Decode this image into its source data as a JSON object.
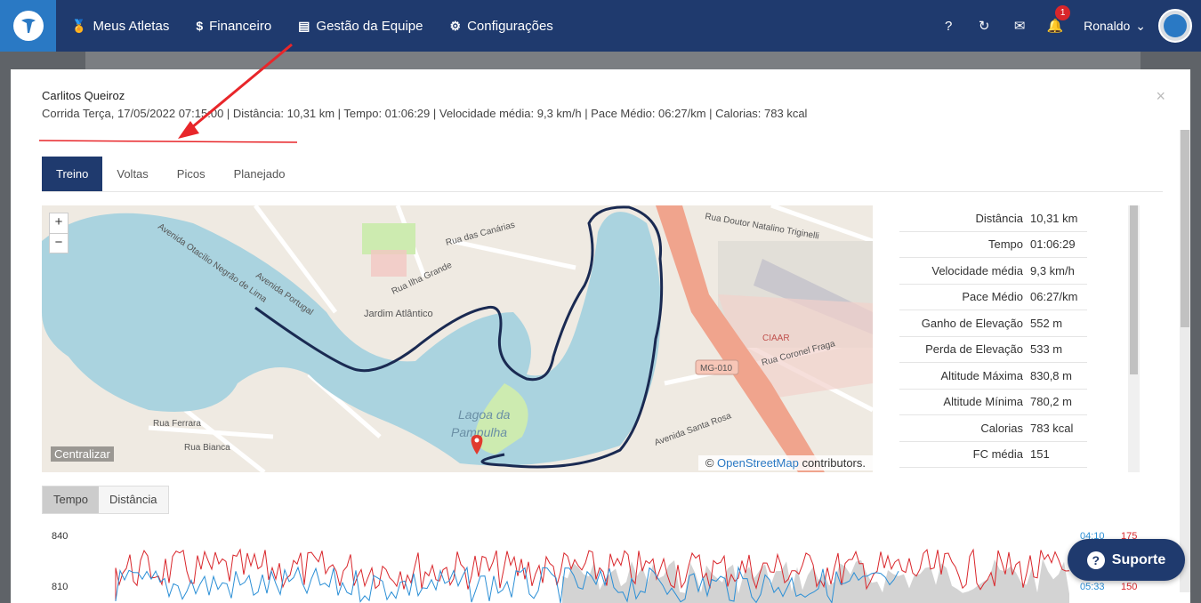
{
  "nav": {
    "items": [
      {
        "icon": "medal-icon",
        "glyph": "🏅",
        "label": "Meus Atletas"
      },
      {
        "icon": "dollar-icon",
        "glyph": "$",
        "label": "Financeiro"
      },
      {
        "icon": "clipboard-icon",
        "glyph": "▤",
        "label": "Gestão da Equipe"
      },
      {
        "icon": "gears-icon",
        "glyph": "⚙",
        "label": "Configurações"
      }
    ],
    "help_glyph": "?",
    "sync_glyph": "↻",
    "mail_glyph": "✉",
    "bell_glyph": "🔔",
    "notification_count": "1",
    "user_name": "Ronaldo",
    "user_caret": "⌄"
  },
  "modal": {
    "athlete_name": "Carlitos Queiroz",
    "activity_info": "Corrida Terça, 17/05/2022 07:15:00 | Distância: 10,31 km | Tempo: 01:06:29 | Velocidade média: 9,3 km/h | Pace Médio: 06:27/km | Calorias: 783 kcal",
    "close_glyph": "×",
    "tabs": [
      "Treino",
      "Voltas",
      "Picos",
      "Planejado"
    ]
  },
  "map": {
    "zoom_in": "+",
    "zoom_out": "−",
    "centralizar": "Centralizar",
    "attribution_prefix": "©",
    "attribution_link": "OpenStreetMap",
    "attribution_suffix": "contributors.",
    "labels": {
      "lagoa1": "Lagoa da",
      "lagoa2": "Pampulha",
      "jardim": "Jardim Atlântico",
      "ciaar": "CIAAR",
      "mg010": "MG-010",
      "av_portugal": "Avenida Portugal",
      "av_otacilio": "Avenida Otacílio Negrão de Lima",
      "av_santa_rosa": "Avenida Santa Rosa",
      "rua_coronel": "Rua Coronel Fraga",
      "rua_trigi": "Rua Doutor Natalino Triginelli",
      "rua_ferrara": "Rua Ferrara",
      "rua_bianca": "Rua Bianca",
      "rua_ilha": "Rua Ilha Grande",
      "rua_canarias": "Rua das Canárias"
    }
  },
  "stats": [
    {
      "label": "Distância",
      "value": "10,31 km"
    },
    {
      "label": "Tempo",
      "value": "01:06:29"
    },
    {
      "label": "Velocidade média",
      "value": "9,3 km/h"
    },
    {
      "label": "Pace Médio",
      "value": "06:27/km"
    },
    {
      "label": "Ganho de Elevação",
      "value": "552 m"
    },
    {
      "label": "Perda de Elevação",
      "value": "533 m"
    },
    {
      "label": "Altitude Máxima",
      "value": "830,8 m"
    },
    {
      "label": "Altitude Mínima",
      "value": "780,2 m"
    },
    {
      "label": "Calorias",
      "value": "783 kcal"
    },
    {
      "label": "FC média",
      "value": "151"
    }
  ],
  "chart_tabs": [
    "Tempo",
    "Distância"
  ],
  "chart_data": {
    "type": "line",
    "y_left_ticks": [
      "840",
      "810"
    ],
    "y_right_pace_ticks": [
      "04:10",
      "05:33"
    ],
    "y_right_hr_ticks": [
      "175",
      "150"
    ],
    "colors": {
      "pace": "#2b8fd6",
      "heart_rate": "#d9262b",
      "elevation": "#c8c8c8"
    }
  },
  "suporte": {
    "label": "Suporte",
    "glyph": "?"
  },
  "colors": {
    "primary": "#1f3a6e",
    "brand": "#2a79c4",
    "annotation": "#e8262a"
  }
}
